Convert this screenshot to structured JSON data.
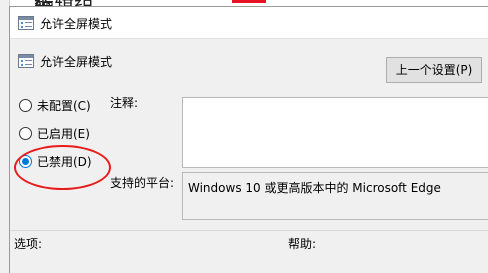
{
  "background": {
    "title_fragment": "编辑组策"
  },
  "dialog": {
    "title": "允许全屏模式",
    "header": "允许全屏模式",
    "prev_setting_button": "上一个设置(P)",
    "options": [
      {
        "label": "未配置(C)",
        "checked": false
      },
      {
        "label": "已启用(E)",
        "checked": false
      },
      {
        "label": "已禁用(D)",
        "checked": true
      }
    ],
    "comment_label": "注释:",
    "comment_value": "",
    "supported_label": "支持的平台:",
    "supported_value": "Windows 10 或更高版本中的 Microsoft Edge",
    "options_label": "选项:",
    "help_label": "帮助:",
    "highlight_color": "#e81b1b",
    "accent_color": "#0078d7"
  }
}
